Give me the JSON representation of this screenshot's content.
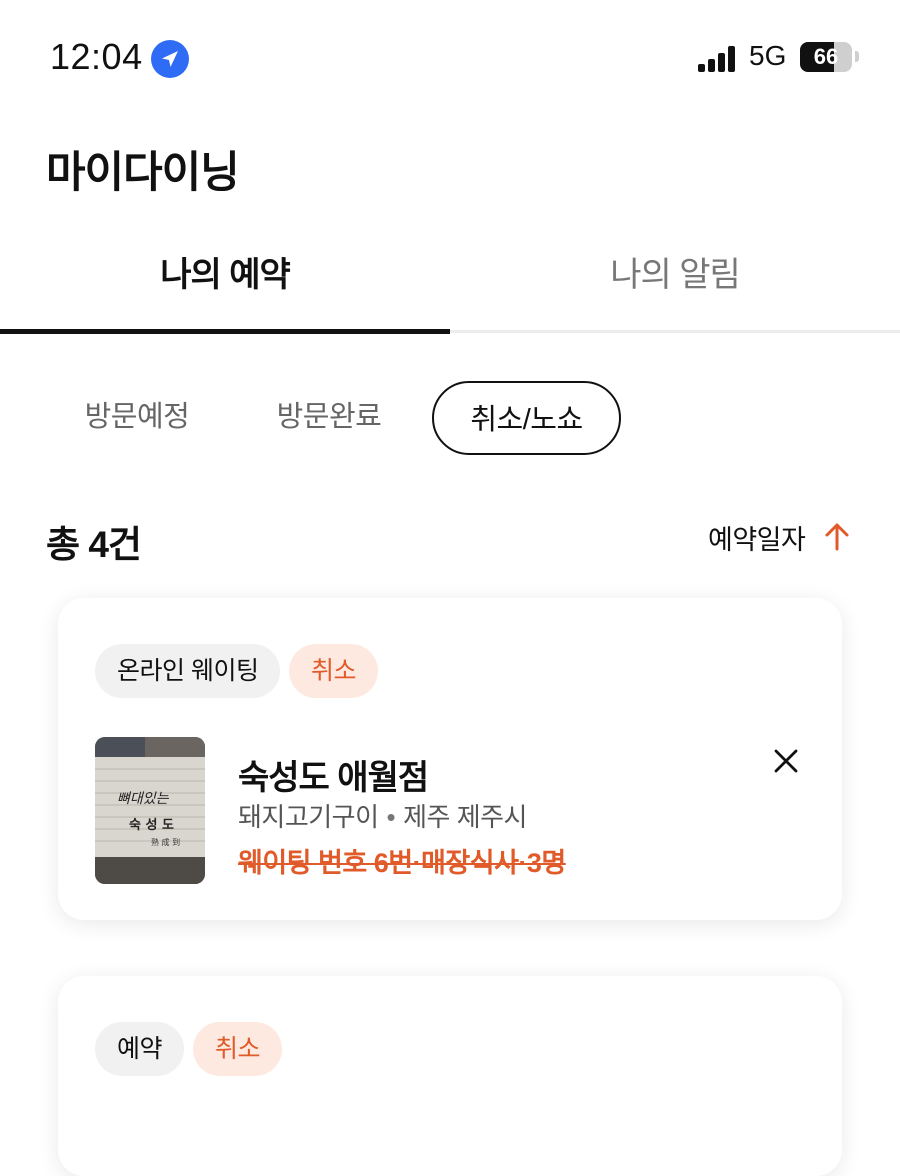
{
  "status_bar": {
    "time": "12:04",
    "network": "5G",
    "battery": "66",
    "battery_level": 0.66,
    "icons": [
      "location-arrow-icon",
      "signal-bars-icon",
      "battery-icon"
    ]
  },
  "page": {
    "title": "마이다이닝"
  },
  "tabs": [
    {
      "label": "나의 예약",
      "active": true
    },
    {
      "label": "나의 알림",
      "active": false
    }
  ],
  "filters": [
    {
      "label": "방문예정",
      "selected": false
    },
    {
      "label": "방문완료",
      "selected": false
    },
    {
      "label": "취소/노쇼",
      "selected": true
    }
  ],
  "summary": {
    "count_label": "총 4건",
    "sort_label": "예약일자",
    "sort_icon": "arrow-up-icon"
  },
  "colors": {
    "accent": "#e05a2a",
    "badge_cancel_bg": "#fde9df",
    "badge_neutral_bg": "#f1f1f1",
    "location_blue": "#2f6cf6"
  },
  "reservations": [
    {
      "type_badge": "온라인 웨이팅",
      "status_badge": "취소",
      "store_name": "숙성도 애월점",
      "category": "돼지고기구이",
      "location": "제주 제주시",
      "separator": "•",
      "detail": "웨이팅 번호 6번·매장식사·3명",
      "thumb_sign_text": "뼈대있는",
      "thumb_sign_name": "숙 성 도",
      "thumb_sign_hanja": "熟 成 到",
      "close_icon": "close-icon"
    },
    {
      "type_badge": "예약",
      "status_badge": "취소"
    }
  ]
}
